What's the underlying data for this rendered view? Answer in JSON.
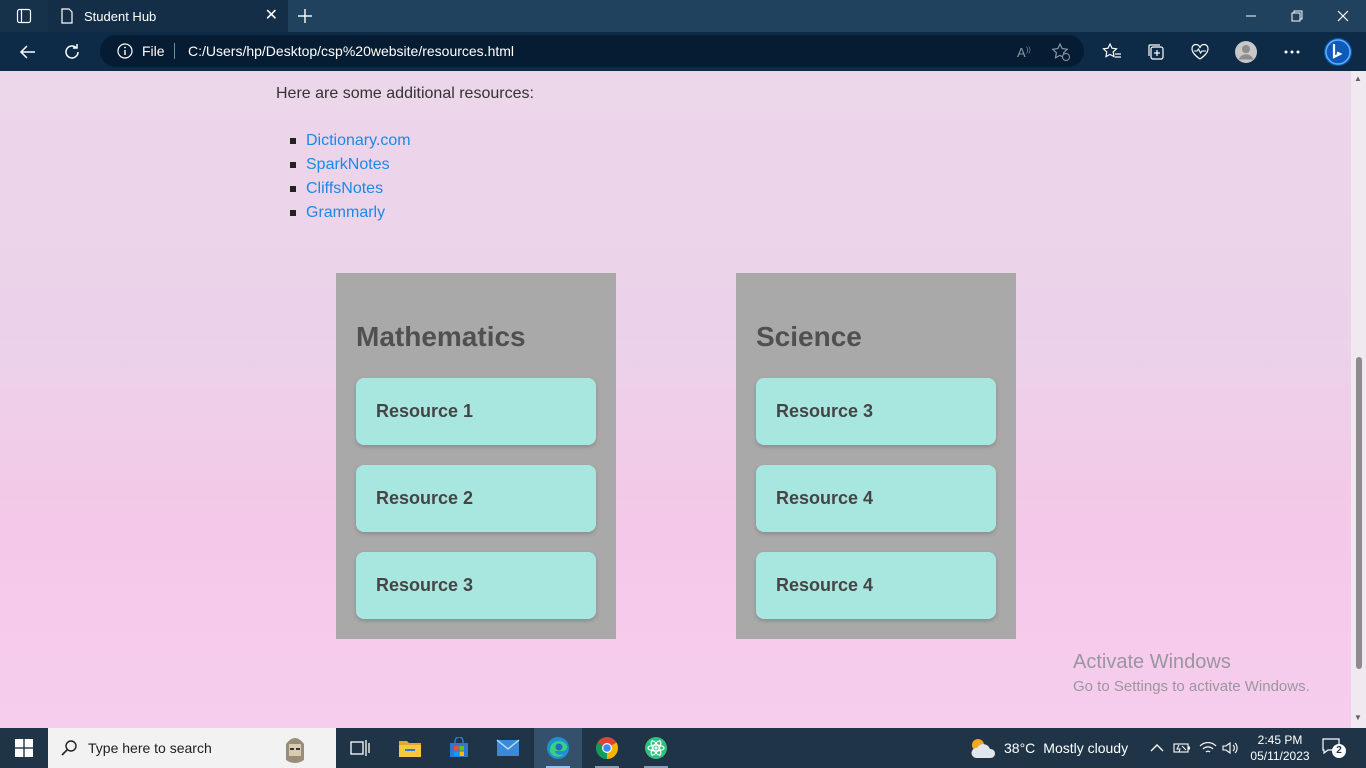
{
  "browser": {
    "tab_title": "Student Hub",
    "address": {
      "scheme_label": "File",
      "url": "C:/Users/hp/Desktop/csp%20website/resources.html"
    }
  },
  "page": {
    "intro": "Here are some additional resources:",
    "links": [
      {
        "label": "Dictionary.com"
      },
      {
        "label": "SparkNotes"
      },
      {
        "label": "CliffsNotes"
      },
      {
        "label": "Grammarly"
      }
    ],
    "subjects": [
      {
        "title": "Mathematics",
        "resources": [
          "Resource 1",
          "Resource 2",
          "Resource 3"
        ]
      },
      {
        "title": "Science",
        "resources": [
          "Resource 3",
          "Resource 4",
          "Resource 4"
        ]
      }
    ],
    "watermark": {
      "line1": "Activate Windows",
      "line2": "Go to Settings to activate Windows."
    }
  },
  "taskbar": {
    "search_placeholder": "Type here to search",
    "weather": {
      "temp": "38°C",
      "condition": "Mostly cloudy"
    },
    "clock": {
      "time": "2:45 PM",
      "date": "05/11/2023"
    },
    "notification_count": "2"
  }
}
